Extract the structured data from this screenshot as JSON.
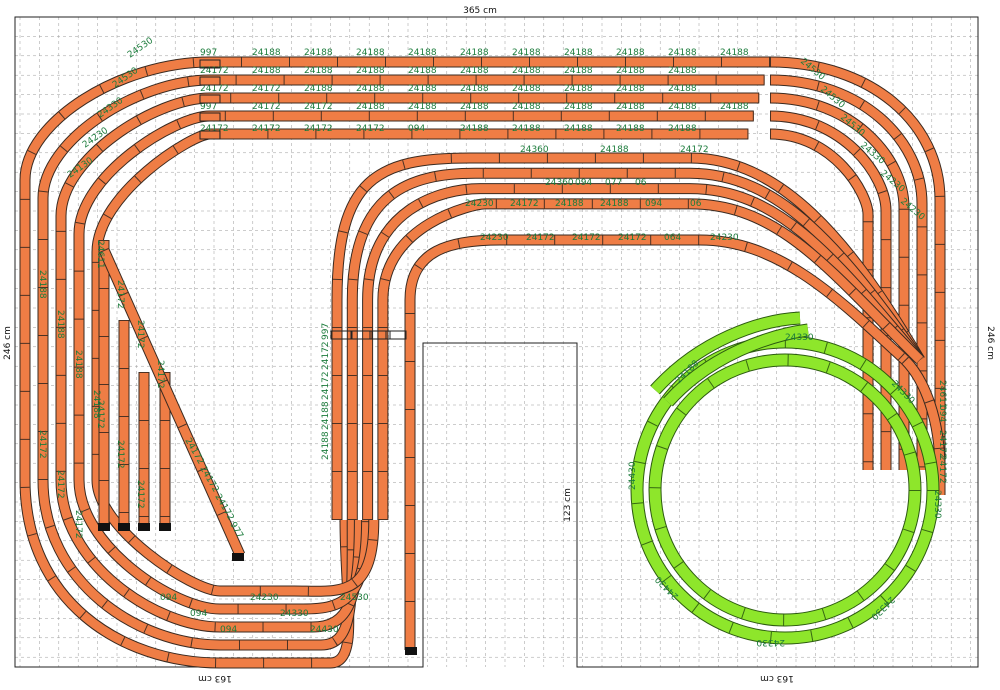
{
  "dimensions": {
    "top": "365 cm",
    "right": "246 cm",
    "left": "246 cm",
    "inner_height": "123 cm",
    "bottom_left": "163 cm",
    "bottom_right": "163 cm"
  },
  "colors": {
    "track": "#ef7d45",
    "track_edge": "#3a2a20",
    "helix": "#8ee62b",
    "helix_edge": "#2c5a10",
    "label": "#1c7c3c",
    "grid": "#9a9a9a",
    "buffer": "#111111"
  },
  "track_labels": {
    "top_row1": [
      "997",
      "24188",
      "24188",
      "24188",
      "24188",
      "24188",
      "24188",
      "24188",
      "24188",
      "24188",
      "24188"
    ],
    "top_row2": [
      "24172",
      "24188",
      "24188",
      "24188",
      "24188",
      "24188",
      "24188",
      "24188",
      "24188",
      "24188"
    ],
    "top_row3": [
      "24172",
      "24172",
      "24188",
      "24188",
      "24188",
      "24188",
      "24188",
      "24188",
      "24188",
      "24188"
    ],
    "top_row4": [
      "997",
      "24172",
      "24172",
      "24188",
      "24188",
      "24188",
      "24188",
      "24188",
      "24188",
      "24188",
      "24188"
    ],
    "top_row5": [
      "24172",
      "24172",
      "24172",
      "24172",
      "094",
      "24188",
      "24188",
      "24188",
      "24188",
      "24188"
    ],
    "mid_row1": [
      "24360",
      "24188",
      "24172"
    ],
    "mid_row2": [
      "24360",
      "094",
      "077",
      "06"
    ],
    "mid_row3": [
      "24230",
      "24172",
      "24188",
      "24188",
      "094",
      "06"
    ],
    "mid_row4": [
      "24230",
      "24172",
      "24172",
      "24172",
      "064",
      "24230"
    ],
    "corner_curve": [
      "24530",
      "24530",
      "24330",
      "24230",
      "24130"
    ],
    "right_curve": [
      "24530",
      "24530",
      "24530",
      "24330",
      "24230",
      "24230"
    ],
    "left_vertical": [
      "24188",
      "24188",
      "24188",
      "24188",
      "24172",
      "24172",
      "24172"
    ],
    "siding_vertical": [
      "24611",
      "24172",
      "24172",
      "24172",
      "24172",
      "24172",
      "24172"
    ],
    "bottom_row": [
      "094",
      "094",
      "094",
      "24230",
      "24330",
      "24430",
      "24530"
    ],
    "center_vertical": [
      "997",
      "24172",
      "24172",
      "24188",
      "24188"
    ],
    "right_vertical": [
      "24611",
      "094",
      "24172",
      "24172"
    ],
    "helix": [
      "24330",
      "24330",
      "24330",
      "24430",
      "24430",
      "24188",
      "24330",
      "24330"
    ]
  },
  "misc": {
    "diag_labels": [
      "24172",
      "24172",
      "24172",
      "977"
    ]
  }
}
